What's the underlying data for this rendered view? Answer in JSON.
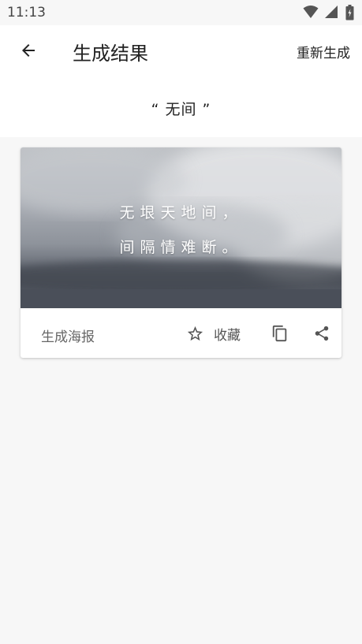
{
  "status_bar": {
    "time": "11:13",
    "icons": [
      "wifi-icon",
      "signal-icon",
      "battery-icon"
    ]
  },
  "app_bar": {
    "back_icon": "arrow-left-icon",
    "title": "生成结果",
    "regenerate_label": "重新生成"
  },
  "query": {
    "text": "“  无间  ”"
  },
  "card": {
    "poem_lines": [
      "无垠天地间，",
      "间隔情难断。"
    ],
    "poster_label": "生成海报",
    "favorite_icon": "star-outline-icon",
    "favorite_label": "收藏",
    "copy_icon": "copy-icon",
    "share_icon": "share-icon"
  },
  "colors": {
    "background": "#f7f7f7",
    "surface": "#ffffff",
    "text_primary": "#222222",
    "text_secondary": "#666666",
    "icon": "#555555"
  }
}
